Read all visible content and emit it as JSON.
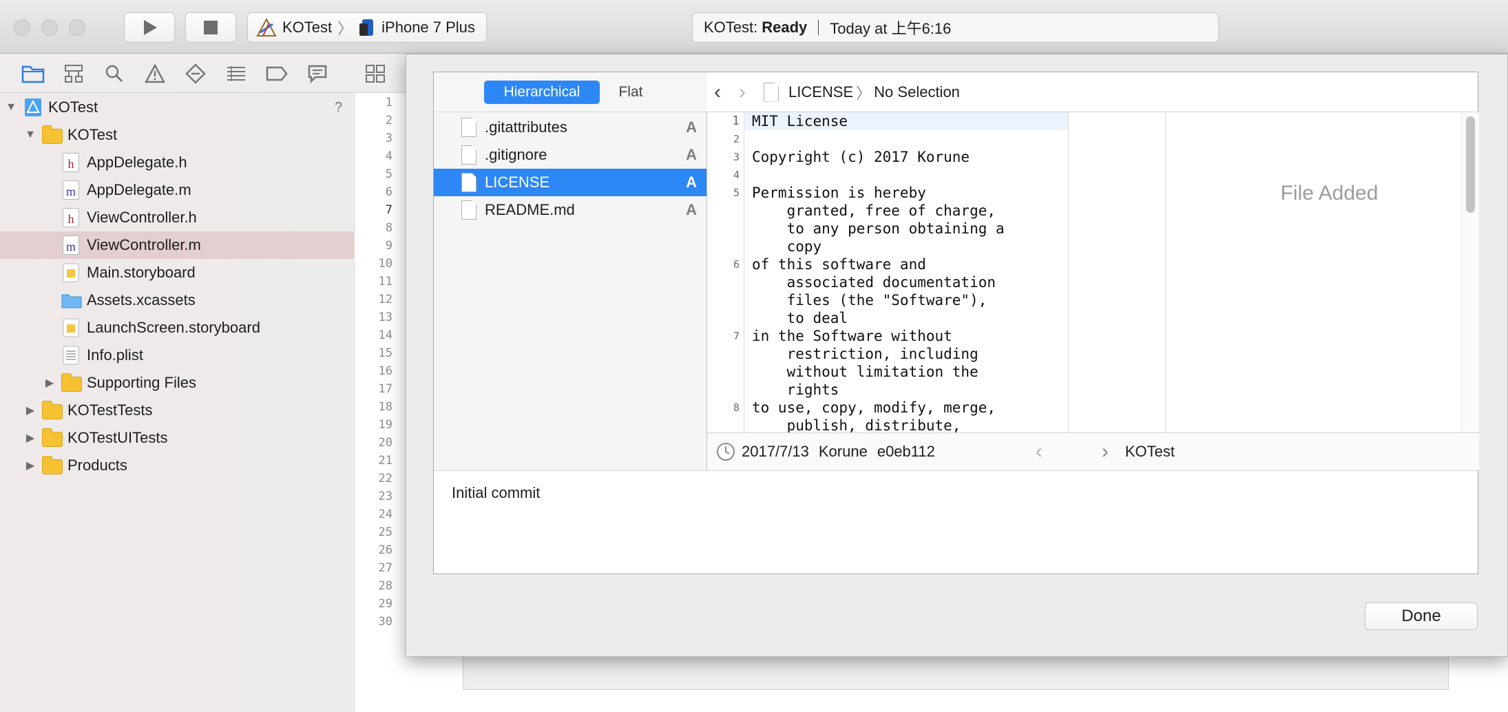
{
  "toolbar": {
    "scheme_target": "KOTest",
    "scheme_device": "iPhone 7 Plus",
    "activity_project": "KOTest:",
    "activity_state": "Ready",
    "activity_time": "Today at 上午6:16"
  },
  "navigator": {
    "help_mark": "?",
    "items": [
      {
        "label": "KOTest",
        "level": 0,
        "kind": "project"
      },
      {
        "label": "KOTest",
        "level": 1,
        "kind": "folder"
      },
      {
        "label": "AppDelegate.h",
        "level": 2,
        "kind": "h"
      },
      {
        "label": "AppDelegate.m",
        "level": 2,
        "kind": "m"
      },
      {
        "label": "ViewController.h",
        "level": 2,
        "kind": "h"
      },
      {
        "label": "ViewController.m",
        "level": 2,
        "kind": "m",
        "selected": true
      },
      {
        "label": "Main.storyboard",
        "level": 2,
        "kind": "storyboard"
      },
      {
        "label": "Assets.xcassets",
        "level": 2,
        "kind": "assets"
      },
      {
        "label": "LaunchScreen.storyboard",
        "level": 2,
        "kind": "storyboard"
      },
      {
        "label": "Info.plist",
        "level": 2,
        "kind": "plist"
      },
      {
        "label": "Supporting Files",
        "level": 2,
        "kind": "folder"
      },
      {
        "label": "KOTestTests",
        "level": 1,
        "kind": "folder"
      },
      {
        "label": "KOTestUITests",
        "level": 1,
        "kind": "folder"
      },
      {
        "label": "Products",
        "level": 1,
        "kind": "folder"
      }
    ]
  },
  "editor": {
    "line_numbers": [
      "1",
      "2",
      "3",
      "4",
      "5",
      "6",
      "7",
      "8",
      "9",
      "10",
      "11",
      "12",
      "13",
      "14",
      "15",
      "16",
      "17",
      "18",
      "19",
      "20",
      "21",
      "22",
      "23",
      "24",
      "25",
      "26",
      "27",
      "28",
      "29",
      "30"
    ]
  },
  "commit_sheet": {
    "view_modes": {
      "hierarchical": "Hierarchical",
      "flat": "Flat"
    },
    "files": [
      {
        "name": ".gitattributes",
        "status": "A"
      },
      {
        "name": ".gitignore",
        "status": "A"
      },
      {
        "name": "LICENSE",
        "status": "A",
        "selected": true
      },
      {
        "name": "README.md",
        "status": "A"
      }
    ],
    "path_file": "LICENSE",
    "path_selection": "No Selection",
    "code_lines": [
      {
        "num": "1",
        "text": "MIT License"
      },
      {
        "num": "2",
        "text": ""
      },
      {
        "num": "3",
        "text": "Copyright (c) 2017 Korune"
      },
      {
        "num": "4",
        "text": ""
      },
      {
        "num": "5",
        "text": "Permission is hereby\n    granted, free of charge,\n    to any person obtaining a\n    copy"
      },
      {
        "num": "6",
        "text": "of this software and\n    associated documentation\n    files (the \"Software\"),\n    to deal"
      },
      {
        "num": "7",
        "text": "in the Software without\n    restriction, including\n    without limitation the\n    rights"
      },
      {
        "num": "8",
        "text": "to use, copy, modify, merge,\n    publish, distribute,"
      }
    ],
    "file_status": "File Added",
    "commit_date": "2017/7/13",
    "commit_author": "Korune",
    "commit_hash": "e0eb112",
    "commit_branch": "KOTest",
    "commit_message": "Initial commit",
    "done_label": "Done"
  }
}
